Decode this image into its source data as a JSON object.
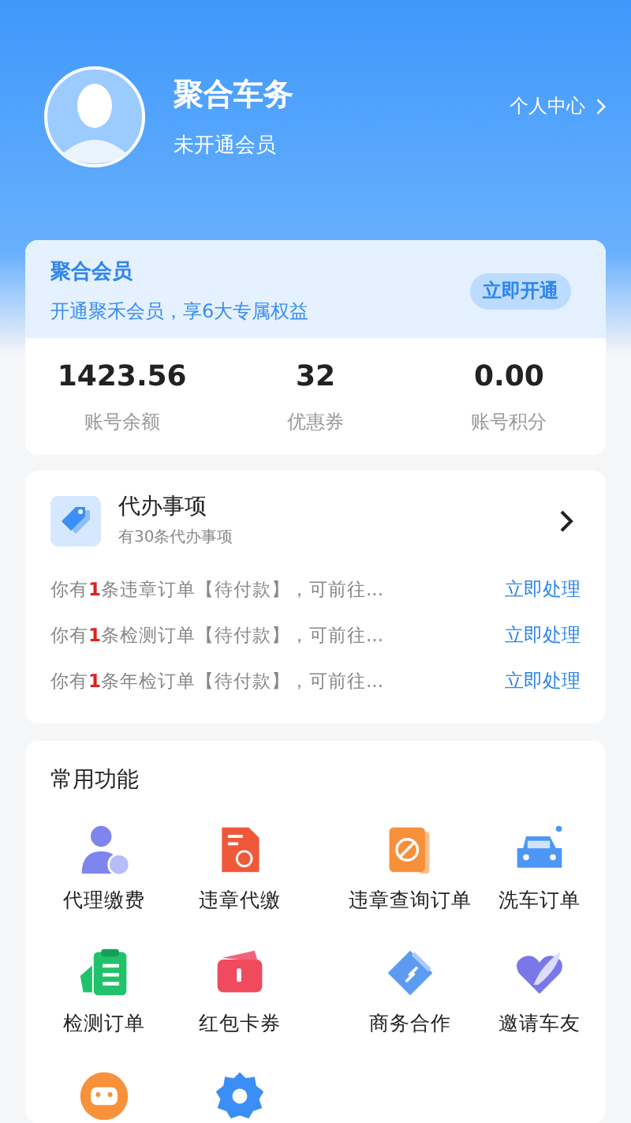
{
  "profile": {
    "name": "聚合车务",
    "status": "未开通会员",
    "link": "个人中心"
  },
  "membership": {
    "title": "聚合会员",
    "subtitle": "开通聚禾会员，享6大专属权益",
    "button": "立即开通"
  },
  "stats": [
    {
      "value": "1423.56",
      "label": "账号余额"
    },
    {
      "value": "32",
      "label": "优惠券"
    },
    {
      "value": "0.00",
      "label": "账号积分"
    }
  ],
  "todo": {
    "title": "代办事项",
    "subtitle": "有30条代办事项",
    "items": [
      {
        "prefix": "你有",
        "count": "1",
        "suffix": "条违章订单【待付款】，可前往...",
        "action": "立即处理"
      },
      {
        "prefix": "你有",
        "count": "1",
        "suffix": "条检测订单【待付款】，可前往...",
        "action": "立即处理"
      },
      {
        "prefix": "你有",
        "count": "1",
        "suffix": "条年检订单【待付款】，可前往...",
        "action": "立即处理"
      }
    ]
  },
  "functions": {
    "title": "常用功能",
    "items": [
      {
        "kind": "person",
        "label": "代理缴费"
      },
      {
        "kind": "document",
        "label": "违章代缴"
      },
      {
        "kind": "book",
        "label": "违章查询订单"
      },
      {
        "kind": "car",
        "label": "洗车订单"
      },
      {
        "kind": "clipboard",
        "label": "检测订单"
      },
      {
        "kind": "wallet",
        "label": "红包卡券"
      },
      {
        "kind": "tag",
        "label": "商务合作"
      },
      {
        "kind": "heart",
        "label": "邀请车友"
      },
      {
        "kind": "robot"
      },
      {
        "kind": "gear"
      }
    ]
  }
}
